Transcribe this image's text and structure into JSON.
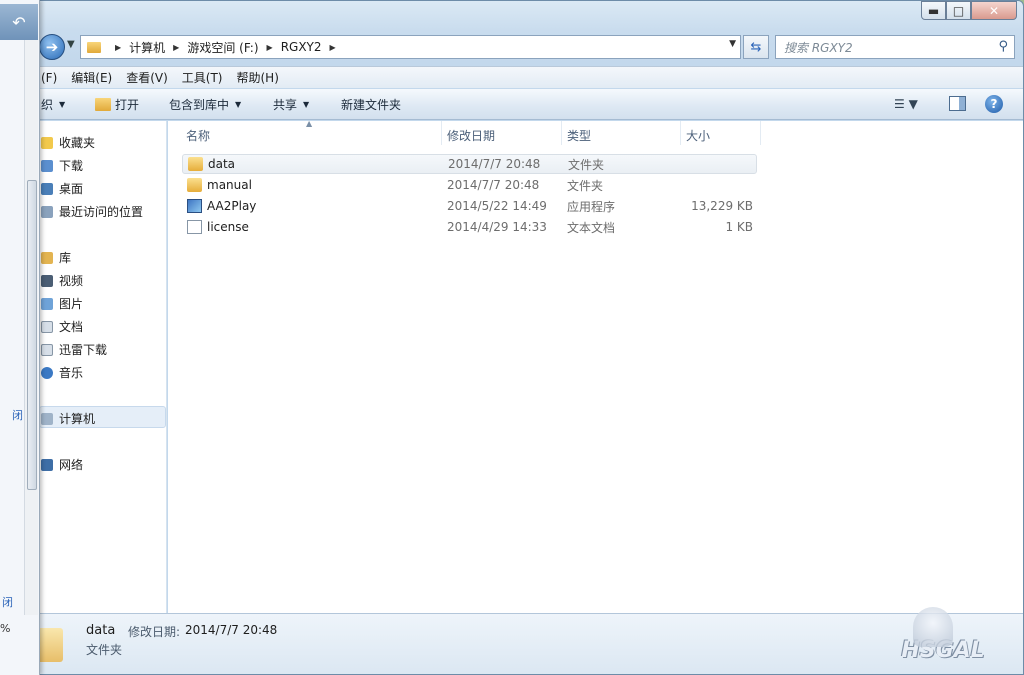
{
  "window": {
    "min_label": "▬",
    "max_label": "□",
    "close_label": "✕"
  },
  "address": {
    "crumbs": [
      "计算机",
      "游戏空间 (F:)",
      "RGXY2"
    ]
  },
  "search": {
    "placeholder": "搜索 RGXY2"
  },
  "menu": {
    "items": [
      "(F)",
      "编辑(E)",
      "查看(V)",
      "工具(T)",
      "帮助(H)"
    ]
  },
  "toolbar": {
    "organize": "织",
    "open": "打开",
    "include": "包含到库中",
    "share": "共享",
    "new_folder": "新建文件夹"
  },
  "nav": {
    "favorites": "收藏夹",
    "downloads": "下载",
    "desktop": "桌面",
    "recent": "最近访问的位置",
    "libraries": "库",
    "videos": "视频",
    "pictures": "图片",
    "documents": "文档",
    "xunlei": "迅雷下载",
    "music": "音乐",
    "computer": "计算机",
    "network": "网络"
  },
  "columns": {
    "name": "名称",
    "date": "修改日期",
    "type": "类型",
    "size": "大小"
  },
  "files": [
    {
      "name": "data",
      "date": "2014/7/7 20:48",
      "type": "文件夹",
      "size": ""
    },
    {
      "name": "manual",
      "date": "2014/7/7 20:48",
      "type": "文件夹",
      "size": ""
    },
    {
      "name": "AA2Play",
      "date": "2014/5/22 14:49",
      "type": "应用程序",
      "size": "13,229 KB"
    },
    {
      "name": "license",
      "date": "2014/4/29 14:33",
      "type": "文本文档",
      "size": "1 KB"
    }
  ],
  "details": {
    "name": "data",
    "date_label": "修改日期:",
    "date_value": "2014/7/7 20:48",
    "type": "文件夹"
  },
  "watermark": {
    "text": "HSGAL"
  },
  "overlay": {
    "pct": "%",
    "t1": "闭",
    "t2": "闭"
  }
}
